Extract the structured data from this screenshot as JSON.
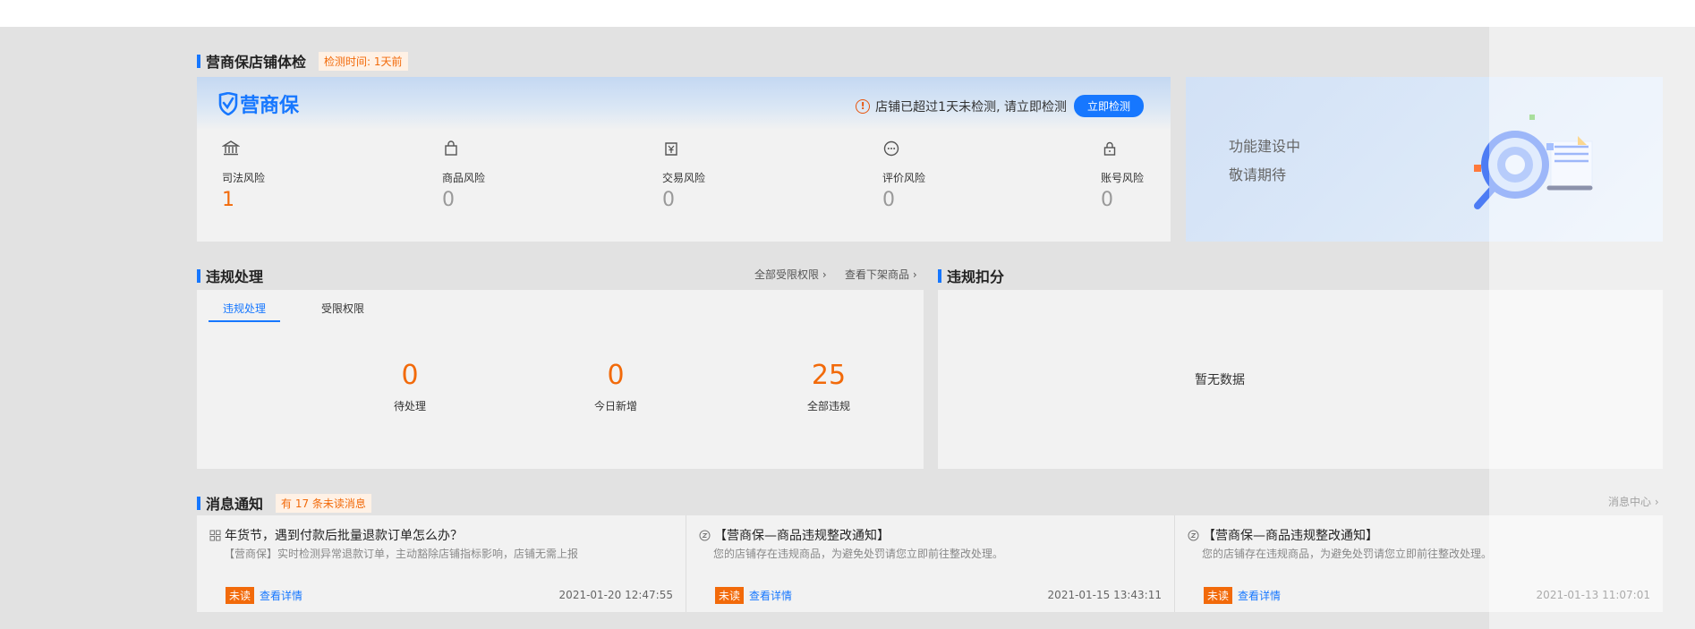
{
  "health": {
    "title": "营商保店铺体检",
    "check_time": "检测时间: 1天前",
    "logo_text": "营商保",
    "warning": "店铺已超过1天未检测, 请立即检测",
    "check_button": "立即检测",
    "risks": [
      {
        "label": "司法风险",
        "value": "1",
        "icon": "bank-icon"
      },
      {
        "label": "商品风险",
        "value": "0",
        "icon": "shopping-bag-icon"
      },
      {
        "label": "交易风险",
        "value": "0",
        "icon": "yen-wallet-icon"
      },
      {
        "label": "评价风险",
        "value": "0",
        "icon": "comment-icon"
      },
      {
        "label": "账号风险",
        "value": "0",
        "icon": "lock-icon"
      }
    ],
    "soon_line1": "功能建设中",
    "soon_line2": "敬请期待"
  },
  "violation": {
    "title": "违规处理",
    "link_all_limits": "全部受限权限",
    "link_removed": "查看下架商品",
    "tabs": [
      "违规处理",
      "受限权限"
    ],
    "stats": [
      {
        "value": "0",
        "label": "待处理"
      },
      {
        "value": "0",
        "label": "今日新增"
      },
      {
        "value": "25",
        "label": "全部违规"
      }
    ]
  },
  "score": {
    "title": "违规扣分",
    "empty": "暂无数据"
  },
  "messages": {
    "title": "消息通知",
    "unread_tag": "有 17 条未读消息",
    "center_link": "消息中心",
    "unread_label": "未读",
    "detail_label": "查看详情",
    "items": [
      {
        "title": "年货节，遇到付款后批量退款订单怎么办？",
        "desc": "【营商保】实时检测异常退款订单，主动豁除店铺指标影响，店铺无需上报",
        "time": "2021-01-20 12:47:55"
      },
      {
        "title": "【营商保—商品违规整改通知】",
        "desc": "您的店铺存在违规商品，为避免处罚请您立即前往整改处理。",
        "time": "2021-01-15 13:43:11"
      },
      {
        "title": "【营商保—商品违规整改通知】",
        "desc": "您的店铺存在违规商品，为避免处罚请您立即前往整改处理。",
        "time": "2021-01-13 11:07:01"
      }
    ]
  },
  "colors": {
    "accent": "#1677ff",
    "alert": "#f26a0a"
  }
}
